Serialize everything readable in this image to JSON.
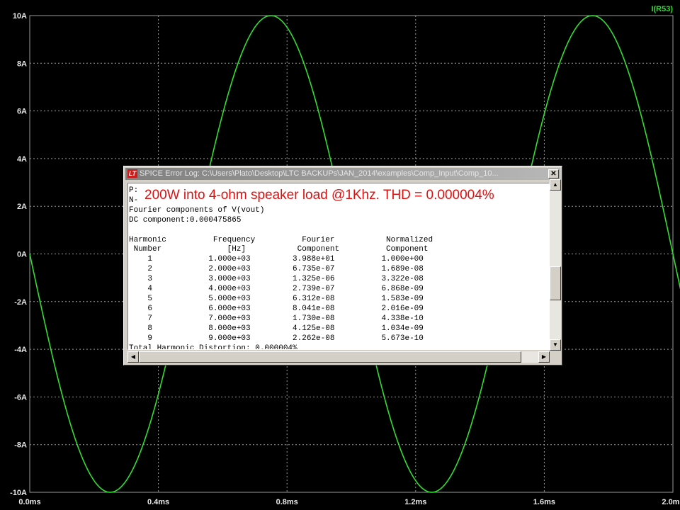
{
  "chart_data": {
    "type": "line",
    "trace_label": "I(R53)",
    "x_ticks": [
      "0.0ms",
      "0.4ms",
      "0.8ms",
      "1.2ms",
      "1.6ms",
      "2.0ms"
    ],
    "y_ticks": [
      "10A",
      "8A",
      "6A",
      "4A",
      "2A",
      "0A",
      "-2A",
      "-4A",
      "-6A",
      "-8A",
      "-10A"
    ],
    "xlim": [
      0,
      2.0
    ],
    "ylim": [
      -10,
      10
    ],
    "x_unit": "ms",
    "y_unit": "A",
    "series": [
      {
        "name": "I(R53)",
        "shape": "sine",
        "amplitude": 10,
        "frequency_hz": 1000,
        "phase": "inverted",
        "color": "#33dd33"
      }
    ],
    "grid": true,
    "background": "#000000"
  },
  "dialog": {
    "title": "SPICE Error Log: C:\\Users\\Plato\\Desktop\\LTC BACKUPs\\JAN_2014\\examples\\Comp_Input\\Comp_10...",
    "close_label": "✕",
    "annotation": "200W into 4-ohm speaker load @1Khz.   THD = 0.000004%",
    "log_lines": [
      "P:",
      "N-",
      "Fourier components of V(vout)",
      "DC component:0.000475865",
      "",
      "Harmonic          Frequency          Fourier           Normalized",
      " Number              [Hz]           Component          Component",
      "    1            1.000e+03         3.988e+01          1.000e+00",
      "    2            2.000e+03         6.735e-07          1.689e-08",
      "    3            3.000e+03         1.325e-06          3.322e-08",
      "    4            4.000e+03         2.739e-07          6.868e-09",
      "    5            5.000e+03         6.312e-08          1.583e-09",
      "    6            6.000e+03         8.041e-08          2.016e-09",
      "    7            7.000e+03         1.730e-08          4.338e-10",
      "    8            8.000e+03         4.125e-08          1.034e-09",
      "    9            9.000e+03         2.262e-08          5.673e-10",
      "Total Harmonic Distortion: 0.000004%"
    ]
  }
}
